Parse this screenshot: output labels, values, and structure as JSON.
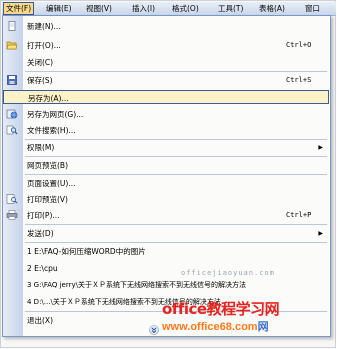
{
  "menubar": {
    "items": [
      {
        "label": "文件(F)",
        "active": true
      },
      {
        "label": "编辑(E)"
      },
      {
        "label": "视图(V)"
      },
      {
        "label": "插入(I)"
      },
      {
        "label": "格式(O)"
      },
      {
        "label": "工具(T)"
      },
      {
        "label": "表格(A)"
      },
      {
        "label": "窗口"
      }
    ]
  },
  "file_menu": {
    "items": [
      {
        "label": "新建(N)...",
        "icon": "new-document-icon"
      },
      {
        "label": "打开(O)...",
        "shortcut": "Ctrl+O",
        "icon": "open-folder-icon"
      },
      {
        "label": "关闭(C)"
      },
      {
        "label": "保存(S)",
        "shortcut": "Ctrl+S",
        "icon": "save-icon"
      },
      {
        "label": "另存为(A)...",
        "highlighted": true
      },
      {
        "label": "另存为网页(G)...",
        "icon": "web-page-icon"
      },
      {
        "label": "文件搜索(H)...",
        "icon": "search-icon"
      },
      {
        "label": "权限(M)",
        "submenu": true
      },
      {
        "label": "网页预览(B)"
      },
      {
        "label": "页面设置(U)..."
      },
      {
        "label": "打印预览(V)",
        "icon": "print-preview-icon"
      },
      {
        "label": "打印(P)...",
        "shortcut": "Ctrl+P",
        "icon": "print-icon"
      },
      {
        "label": "发送(D)",
        "submenu": true
      },
      {
        "label": "1 E:\\FAQ-如何压缩WORD中的图片"
      },
      {
        "label": "2 E:\\cpu"
      },
      {
        "label": "3 G:\\FAQ jerry\\关于ＸＰ系统下无线网络搜索不到无线信号的解决方法"
      },
      {
        "label": "4 D:\\...\\关于ＸＰ系统下无线网络搜索不到无线信号的解决方法"
      },
      {
        "label": "退出(X)"
      }
    ],
    "expand_icon": "double-chevron-down-icon"
  },
  "watermark": "officejiaoyuan.com",
  "brand": {
    "name": "office教程学习网",
    "url_prefix": "www.office68.com",
    "url_suffix": "网"
  }
}
